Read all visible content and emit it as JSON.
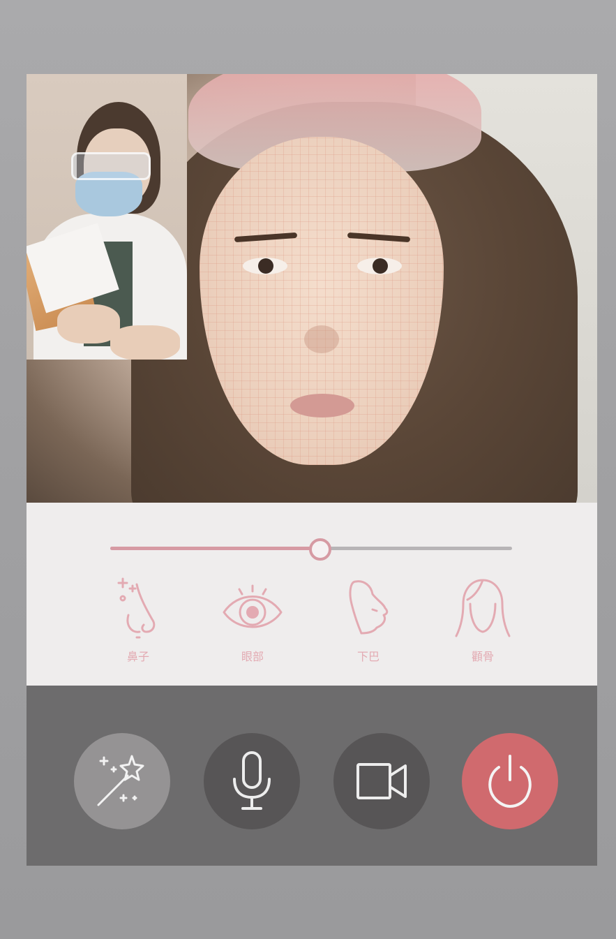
{
  "colors": {
    "accent_pink": "#d69aa3",
    "label_pink": "#e3aab2",
    "control_bar": "#6d6c6d",
    "end_call": "#d06a6e"
  },
  "video": {
    "main_feed": "face-mesh-video",
    "pip_feed": "doctor-video"
  },
  "slider": {
    "value_fraction": 0.52
  },
  "features": [
    {
      "label": "鼻子",
      "icon": "nose-icon"
    },
    {
      "label": "眼部",
      "icon": "eye-icon"
    },
    {
      "label": "下巴",
      "icon": "chin-icon"
    },
    {
      "label": "顴骨",
      "icon": "cheekbone-icon"
    }
  ],
  "controls": [
    {
      "icon": "magic-wand-icon"
    },
    {
      "icon": "microphone-icon"
    },
    {
      "icon": "video-camera-icon"
    },
    {
      "icon": "power-icon"
    }
  ]
}
